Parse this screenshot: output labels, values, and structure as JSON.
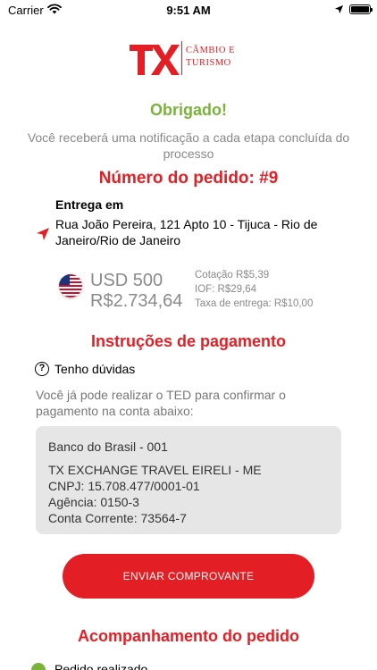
{
  "status_bar": {
    "carrier": "Carrier",
    "time": "9:51 AM",
    "wifi_icon": "wifi-icon",
    "location_icon": "location-arrow-icon",
    "battery_icon": "battery-full-icon"
  },
  "logo": {
    "mark": "TX",
    "line1": "CÂMBIO E",
    "line2": "TURISMO",
    "color": "#e31e24"
  },
  "confirmation": {
    "title": "Obrigado!",
    "notice": "Você receberá uma notificação a cada etapa concluída do processo",
    "order_number": "Número do pedido: #9"
  },
  "delivery": {
    "label": "Entrega em",
    "icon": "location-arrow-icon",
    "address": "Rua João Pereira, 121 Apto 10 - Tijuca - Rio de Janeiro/Rio de Janeiro"
  },
  "amount": {
    "flag_icon": "us-flag-icon",
    "foreign": "USD 500",
    "brl": "R$2.734,64",
    "rate": "Cotação R$5,39",
    "iof": "IOF: R$29,64",
    "delivery_fee": "Taxa de entrega: R$10,00"
  },
  "payment": {
    "title": "Instruções de pagamento",
    "help_icon": "question-circle-icon",
    "help_label": "Tenho dúvidas",
    "ted_text": "Você já pode realizar o TED para confirmar o pagamento na conta abaixo:",
    "bank": {
      "name": "Banco do Brasil - 001",
      "holder": "TX EXCHANGE TRAVEL EIRELI - ME",
      "cnpj": "CNPJ: 15.708.477/0001-01",
      "agency": "Agência: 0150-3",
      "account": "Conta Corrente: 73564-7"
    },
    "send_button": "ENVIAR COMPROVANTE"
  },
  "tracking": {
    "title": "Acompanhamento do pedido",
    "check_icon": "check-circle-icon",
    "first_step": "Pedido realizado"
  },
  "colors": {
    "brand_red": "#e31e24",
    "success_green": "#7ab33a",
    "muted_text": "#888888",
    "box_background": "#e6e6e6"
  }
}
